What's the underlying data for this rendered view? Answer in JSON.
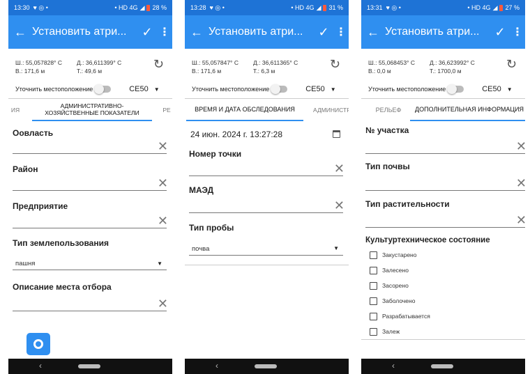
{
  "screens": [
    {
      "status": {
        "time": "13:30",
        "network": "• HD 4G",
        "battery": "28 %"
      },
      "title": "Установить атри...",
      "lat": "Ш.: 55,057828° С",
      "lon": "Д.: 36,611399° С",
      "alt": "В.: 171,6 м",
      "acc": "Т.: 49,6 м",
      "refine_label": "Уточнить местоположение",
      "ce_value": "CE50",
      "tabs": [
        "ИЯ",
        "АДМИНИСТРАТИВНО-ХОЗЯЙСТВЕННЫЕ ПОКАЗАТЕЛИ",
        "РЕ"
      ],
      "fields": [
        "Оовласть",
        "Район",
        "Предприятие"
      ],
      "land_use_label": "Тип землепользования",
      "land_use_value": "пашня",
      "sample_desc_label": "Описание места отбора"
    },
    {
      "status": {
        "time": "13:28",
        "network": "• HD 4G",
        "battery": "31 %"
      },
      "title": "Установить атри...",
      "lat": "Ш.: 55,057847° С",
      "lon": "Д.: 36,611365° С",
      "alt": "В.: 171,6 м",
      "acc": "Т.: 6,3 м",
      "refine_label": "Уточнить местоположение",
      "ce_value": "CE50",
      "tabs": [
        "ВРЕМЯ И ДАТА ОБСЛЕДОВАНИЯ",
        "АДМИНИСТР"
      ],
      "date_value": "24 июн. 2024 г. 13:27:28",
      "fields": [
        "Номер точки",
        "МАЭД"
      ],
      "sample_type_label": "Тип пробы",
      "sample_type_value": "почва"
    },
    {
      "status": {
        "time": "13:31",
        "network": "• HD 4G",
        "battery": "27 %"
      },
      "title": "Установить атри...",
      "lat": "Ш.: 55,068453° С",
      "lon": "Д.: 36,623992° С",
      "alt": "В.: 0,0 м",
      "acc": "Т.: 1700,0 м",
      "refine_label": "Уточнить местоположение",
      "ce_value": "CE50",
      "tabs": [
        "РЕЛЬЕФ",
        "ДОПОЛНИТЕЛЬНАЯ ИНФОРМАЦИЯ"
      ],
      "fields": [
        "№ участка",
        "Тип почвы",
        "Тип растительности"
      ],
      "culture_label": "Культуртехническое состояние",
      "culture_options": [
        "Закустарено",
        "Залесено",
        "Засорено",
        "Заболочено",
        "Разрабатывается",
        "Залеж"
      ]
    }
  ],
  "colors": {
    "statusbar": "#1e73d6",
    "appbar": "#2f8ff0",
    "accent": "#2f8ff0"
  }
}
